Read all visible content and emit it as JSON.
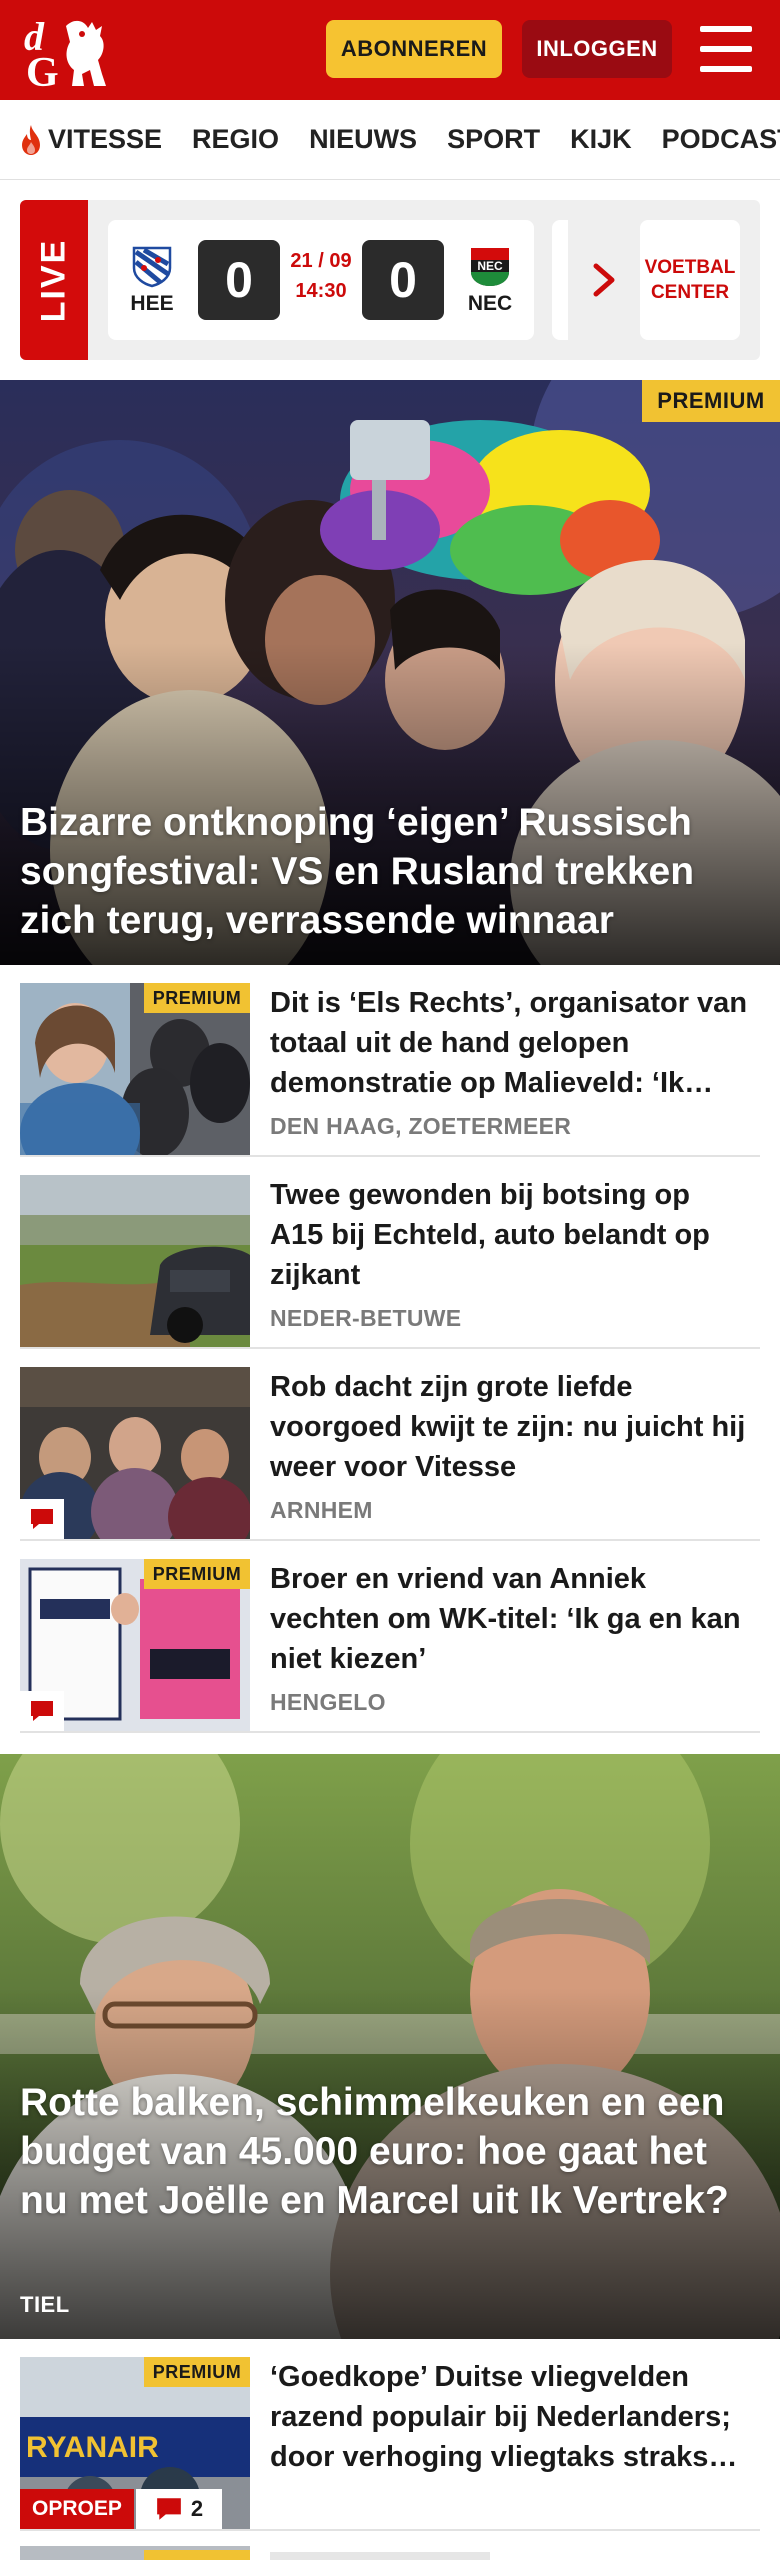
{
  "brand": {
    "logo_text": "dG",
    "accent": "#cc0a0a"
  },
  "header": {
    "subscribe_label": "ABONNEREN",
    "login_label": "INLOGGEN"
  },
  "nav": {
    "items": [
      "VITESSE",
      "REGIO",
      "NIEUWS",
      "SPORT",
      "KIJK",
      "PODCAST"
    ]
  },
  "live": {
    "label": "LIVE",
    "match": {
      "home": "HEE",
      "away": "NEC",
      "home_score": "0",
      "away_score": "0",
      "date": "21 / 09",
      "time": "14:30"
    },
    "center_label": "VOETBAL CENTER"
  },
  "hero": {
    "badge": "PREMIUM",
    "title": "Bizarre ontknoping ‘eigen’ Russisch songfestival: VS en Rusland trekken zich terug, verrassende winnaar"
  },
  "articles": [
    {
      "title": "Dit is ‘Els Rechts’, organisator van totaal uit de hand gelopen demonstratie op Malieveld: ‘Ik…",
      "location": "DEN HAAG, ZOETERMEER",
      "badge": "PREMIUM"
    },
    {
      "title": "Twee gewonden bij botsing op A15 bij Echteld, auto belandt op zijkant",
      "location": "NEDER-BETUWE"
    },
    {
      "title": "Rob dacht zijn grote liefde voorgoed kwijt te zijn: nu juicht hij weer voor Vitesse",
      "location": "ARNHEM"
    },
    {
      "title": "Broer en vriend van Anniek vechten om WK-titel: ‘Ik ga en kan niet kiezen’",
      "location": "HENGELO",
      "badge": "PREMIUM"
    }
  ],
  "hero2": {
    "title": "Rotte balken, schimmelkeuken en een budget van 45.000 euro: hoe gaat het nu met Joëlle en Marcel uit Ik Vertrek?",
    "location": "TIEL"
  },
  "article_last": {
    "title": "‘Goedkope’ Duitse vliegvelden razend populair bij Nederlanders; door verhoging vliegtaks straks…",
    "badge": "PREMIUM",
    "tag": "OPROEP",
    "comments": "2",
    "thumb_text": "RYANAIR"
  }
}
